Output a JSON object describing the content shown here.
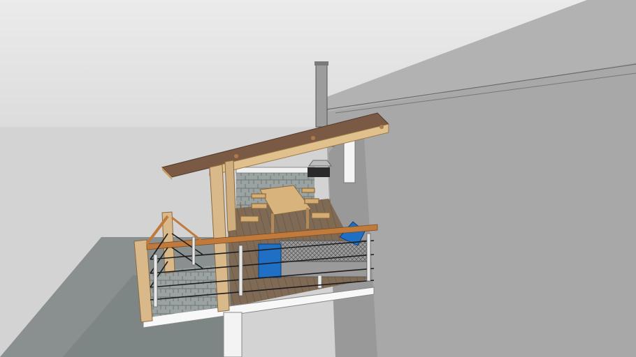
{
  "scene": {
    "description_title": "",
    "sky_color": "#e4e4e4",
    "ground_color": "#d2d2d2",
    "wall_color": "#a9a9a9",
    "wall_shade_color": "#9a9a9a",
    "roof_color": "#7b5a45",
    "wood_color": "#d9b98a",
    "deck_color": "#806a55",
    "railing_color": "#c07a3c",
    "cable_color": "#202020",
    "cushion_color": "#1f6fc4",
    "sofa_color": "#8c8c8c"
  }
}
